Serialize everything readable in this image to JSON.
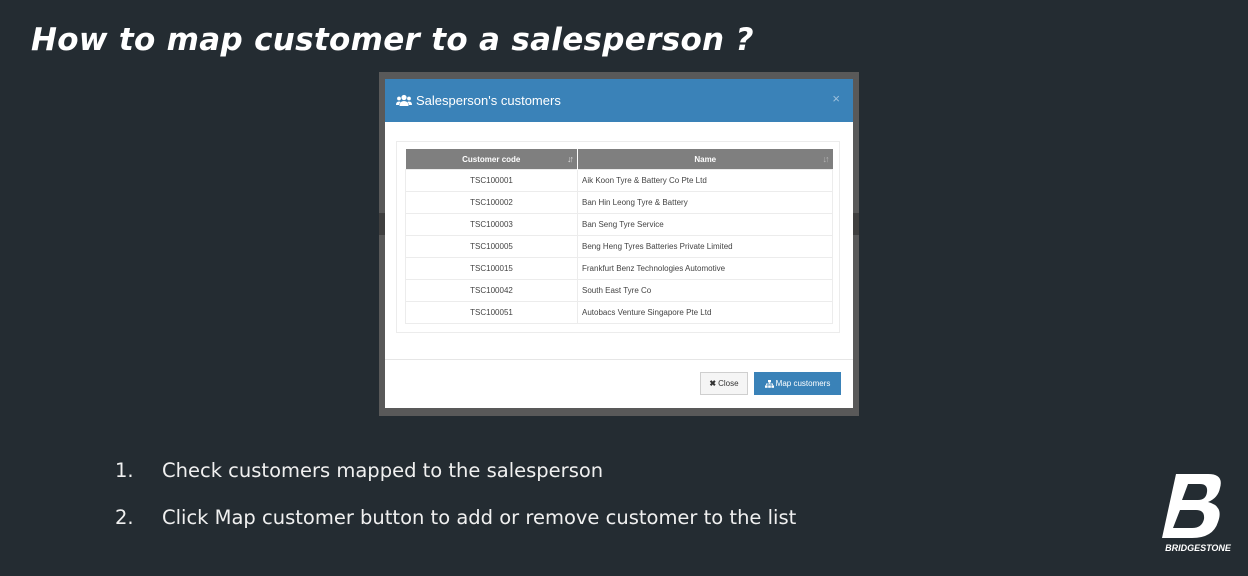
{
  "slide": {
    "title": "How to map customer to a salesperson ?"
  },
  "modal": {
    "title": "Salesperson's customers",
    "close_x": "×",
    "table": {
      "headers": [
        "Customer code",
        "Name"
      ],
      "rows": [
        {
          "code": "TSC100001",
          "name": "Aik Koon Tyre & Battery Co Pte Ltd"
        },
        {
          "code": "TSC100002",
          "name": "Ban Hin Leong Tyre & Battery"
        },
        {
          "code": "TSC100003",
          "name": "Ban Seng Tyre Service"
        },
        {
          "code": "TSC100005",
          "name": "Beng Heng Tyres Batteries Private Limited"
        },
        {
          "code": "TSC100015",
          "name": "Frankfurt Benz Technologies Automotive"
        },
        {
          "code": "TSC100042",
          "name": "South East Tyre Co"
        },
        {
          "code": "TSC100051",
          "name": "Autobacs Venture Singapore Pte Ltd"
        }
      ]
    },
    "footer": {
      "close_label": "Close",
      "map_label": "Map customers"
    }
  },
  "steps": [
    {
      "num": "1.",
      "text": "Check customers mapped to the salesperson"
    },
    {
      "num": "2.",
      "text": "Click Map customer button to add or remove customer to the list"
    }
  ],
  "logo": {
    "text": "BRIDGESTONE"
  },
  "colors": {
    "background": "#242c32",
    "modal_header": "#3a82b8",
    "table_header": "#7f7f7f"
  }
}
